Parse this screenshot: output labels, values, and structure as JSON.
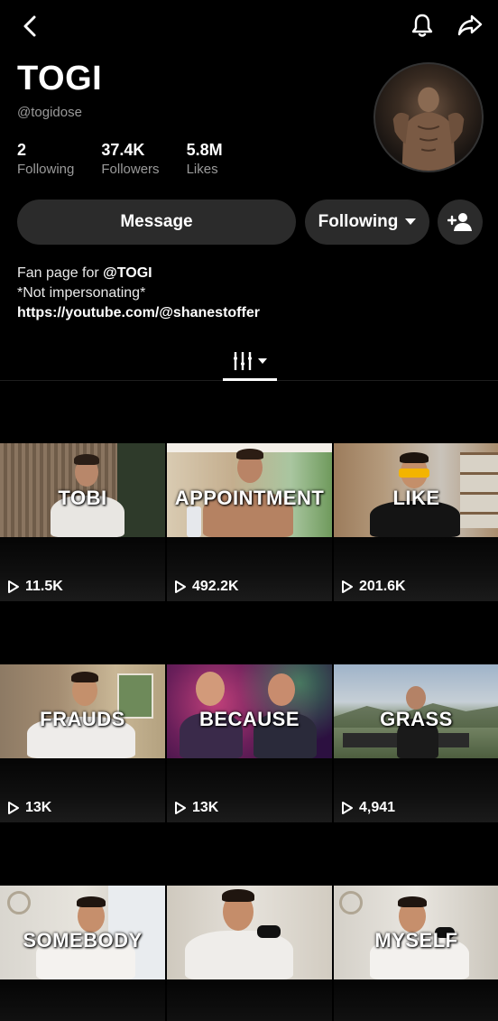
{
  "profile": {
    "display_name": "TOGI",
    "username": "@togidose",
    "stats": [
      {
        "value": "2",
        "label": "Following"
      },
      {
        "value": "37.4K",
        "label": "Followers"
      },
      {
        "value": "5.8M",
        "label": "Likes"
      }
    ],
    "bio_line1_prefix": "Fan page for ",
    "bio_line1_mention": "@TOGI",
    "bio_line2": "*Not impersonating*",
    "bio_link": "https://youtube.com/@shanestoffer"
  },
  "actions": {
    "message_label": "Message",
    "following_label": "Following"
  },
  "icons": {
    "back": "chevron-left-icon",
    "bell": "bell-icon",
    "share": "share-arrow-icon",
    "add_user": "add-user-icon",
    "grid_tab": "videos-grid-icon"
  },
  "videos": [
    {
      "caption": "TOBI",
      "views": "11.5K"
    },
    {
      "caption": "APPOINTMENT",
      "views": "492.2K"
    },
    {
      "caption": "LIKE",
      "views": "201.6K"
    },
    {
      "caption": "FRAUDS",
      "views": "13K"
    },
    {
      "caption": "BECAUSE",
      "views": "13K"
    },
    {
      "caption": "GRASS",
      "views": "4,941"
    },
    {
      "caption": "SOMEBODY",
      "views": ""
    },
    {
      "caption": "",
      "views": ""
    },
    {
      "caption": "MYSELF",
      "views": ""
    }
  ]
}
